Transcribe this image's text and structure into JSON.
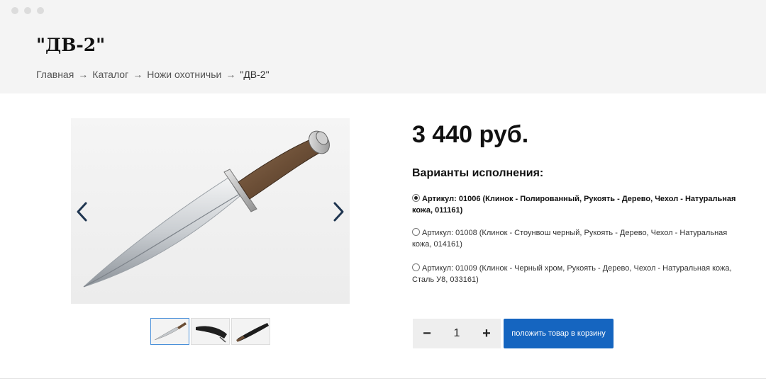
{
  "header": {
    "title": "\"ДВ-2\"",
    "breadcrumb": [
      {
        "label": "Главная"
      },
      {
        "label": "Каталог"
      },
      {
        "label": "Ножи охотничьи"
      },
      {
        "label": "\"ДВ-2\""
      }
    ],
    "separator": "→"
  },
  "gallery": {
    "prev_icon": "chevron-left-icon",
    "next_icon": "chevron-right-icon",
    "thumbnails": [
      {
        "name": "knife-thumbnail",
        "active": true
      },
      {
        "name": "sheath-thumbnail",
        "active": false
      },
      {
        "name": "knife-in-sheath-thumbnail",
        "active": false
      }
    ]
  },
  "product": {
    "price": "3 440 руб.",
    "variants_title": "Варианты исполнения:",
    "variants": [
      {
        "label": "Артикул: 01006 (Клинок - Полированный, Рукоять - Дерево, Чехол - Натуральная кожа, 011161)",
        "selected": true
      },
      {
        "label": "Артикул: 01008 (Клинок - Стоунвош черный, Рукоять - Дерево, Чехол - Натуральная кожа, 014161)",
        "selected": false
      },
      {
        "label": "Артикул: 01009 (Клинок - Черный хром, Рукоять - Дерево, Чехол - Натуральная кожа, Сталь У8, 033161)",
        "selected": false
      }
    ]
  },
  "cart": {
    "minus": "−",
    "quantity": "1",
    "plus": "+",
    "add_label": "положить товар в корзину"
  },
  "colors": {
    "accent": "#1565c0",
    "header_bg": "#f4f4f4",
    "arrow": "#1f3550"
  }
}
